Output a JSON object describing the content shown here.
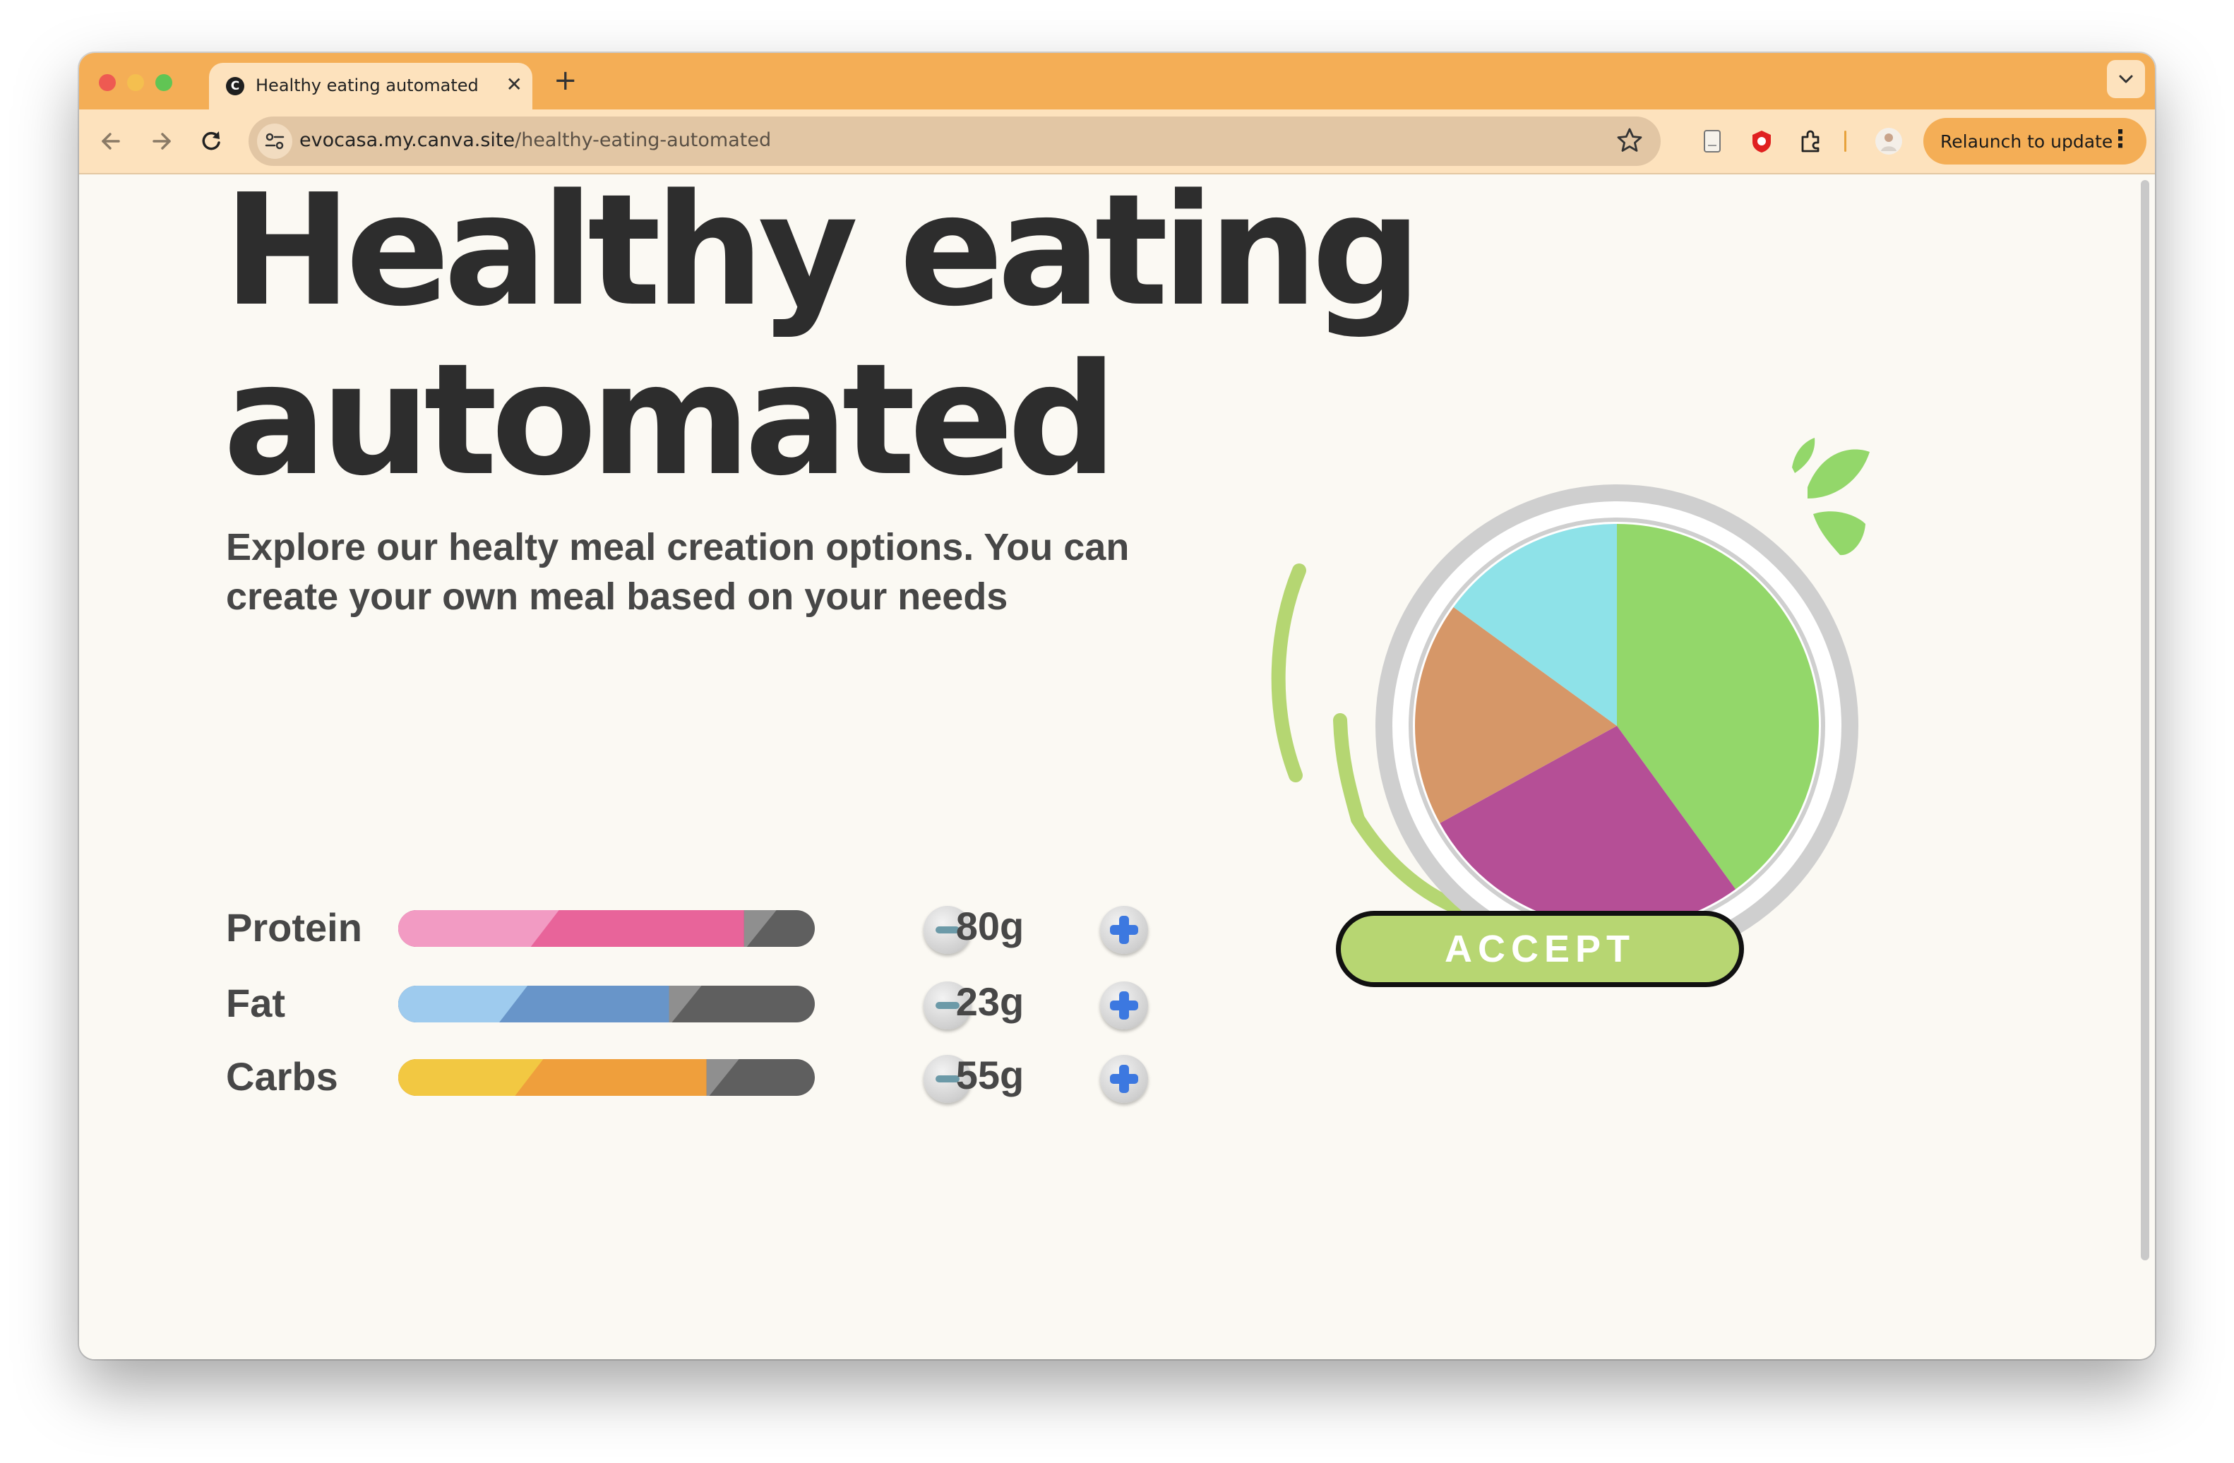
{
  "browser": {
    "tab_title": "Healthy eating automated",
    "tab_favicon": "C",
    "new_tab": "+",
    "url_host": "evocasa.my.canva.site",
    "url_path": "/healthy-eating-automated",
    "relaunch_label": "Relaunch to update"
  },
  "hero": {
    "headline_line1": "Healthy eating",
    "headline_line2": "automated",
    "subtitle_line1": "Explore our healty meal creation options. You can",
    "subtitle_line2": "create your own meal based on your needs"
  },
  "macros": [
    {
      "label": "Protein",
      "value": "80g",
      "fill": 0.83,
      "colors": {
        "light": "#f29bc3",
        "dark": "#e8649a"
      }
    },
    {
      "label": "Fat",
      "value": "23g",
      "fill": 0.65,
      "colors": {
        "light": "#9ecbee",
        "dark": "#6895c9"
      }
    },
    {
      "label": "Carbs",
      "value": "55g",
      "fill": 0.74,
      "colors": {
        "light": "#f2c842",
        "dark": "#ef9f3c"
      }
    }
  ],
  "plate": {
    "slices": [
      {
        "name": "green",
        "fraction": 0.4,
        "color": "#93d76a"
      },
      {
        "name": "magenta",
        "fraction": 0.27,
        "color": "#b54f96"
      },
      {
        "name": "orange",
        "fraction": 0.18,
        "color": "#d69768"
      },
      {
        "name": "cyan",
        "fraction": 0.15,
        "color": "#8ee2e8"
      }
    ]
  },
  "accept_label": "ACCEPT",
  "colors": {
    "tab_bar": "#f4ae56",
    "toolbar": "#fde2bd",
    "page_bg": "#fbf9f3",
    "text_dark": "#2d2d2d",
    "accent_green": "#b7d672"
  }
}
